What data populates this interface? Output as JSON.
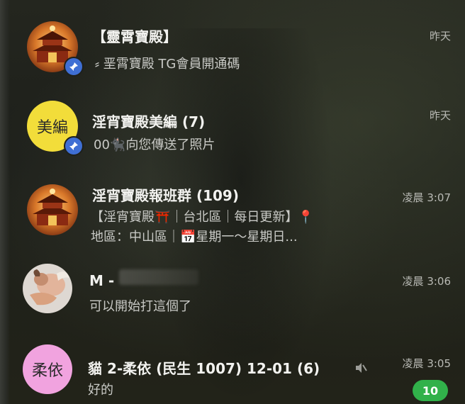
{
  "chats": [
    {
      "name": "【靈霄寶殿】",
      "preview": "⸗ 垩霄寶殿 TG會員開通碼",
      "time": "昨天",
      "avatar": "temple-avatar",
      "pinned": true
    },
    {
      "name": "淫宵寶殿美編 (7)",
      "preview": "00🐈‍⬛向您傳送了照片",
      "time": "昨天",
      "avatar_text": "美編",
      "avatar_color": "#f2dd3a",
      "pinned": true
    },
    {
      "name": "淫宵寶殿報班群 (109)",
      "preview_line1": "【淫宵寶殿⛩️｜台北區｜每日更新】📍",
      "preview_line2": "地區：中山區｜📅星期一～星期日...",
      "time": "凌晨 3:07",
      "avatar": "temple-avatar"
    },
    {
      "name": "M -",
      "preview": "可以開始打這個了",
      "time": "凌晨 3:06",
      "avatar": "cupid-avatar"
    },
    {
      "name": "貓 2-柔依 (民生 1007) 12-01 (6)",
      "preview": "好的",
      "time": "凌晨 3:05",
      "avatar_text": "柔依",
      "avatar_color": "#f1a3df",
      "unread": "10",
      "muted": true
    }
  ],
  "colors": {
    "pin_badge": "#3f6fd4",
    "unread_badge": "#31b14a"
  },
  "icons": {
    "pin": "pin-icon",
    "mute": "mute-icon"
  }
}
